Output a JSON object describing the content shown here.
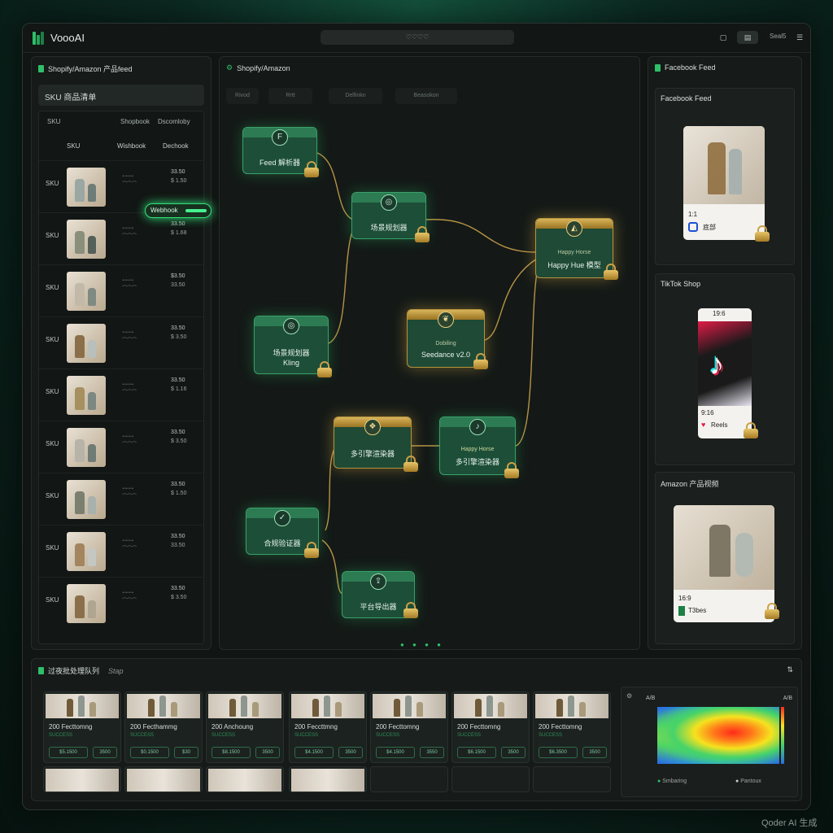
{
  "app": {
    "title": "VoooAI",
    "omnibox": "♡♡♡♡",
    "top_right_label": "Seal5",
    "watermark": "Qoder AI 生成"
  },
  "left_panel": {
    "title": "Shopify/Amazon 产品feed",
    "subbar": "SKU  商品清单",
    "header_top": {
      "c1": "SKU",
      "c2": "Shopbook",
      "c3": "Dscomloby"
    },
    "header": {
      "c1": "SKU",
      "c2": "Wishbook",
      "c3": "Dechook"
    },
    "rows": [
      {
        "sku": "SKU",
        "v1": "33.50",
        "v2": "$ 1.50"
      },
      {
        "sku": "SKU",
        "v1": "33.50",
        "v2": "$ 1.68"
      },
      {
        "sku": "SKU",
        "v1": "$3.50",
        "v2": "33.50"
      },
      {
        "sku": "SKU",
        "v1": "33.50",
        "v2": "$ 3.50"
      },
      {
        "sku": "SKU",
        "v1": "33.50",
        "v2": "$ 1.16"
      },
      {
        "sku": "SKU",
        "v1": "33.50",
        "v2": "$ 3.50"
      },
      {
        "sku": "SKU",
        "v1": "33.50",
        "v2": "$ 1.50"
      },
      {
        "sku": "SKU",
        "v1": "33.50",
        "v2": "33.50"
      },
      {
        "sku": "SKU",
        "v1": "33.50",
        "v2": "$ 3.50"
      }
    ],
    "webhook_label": "Webhook"
  },
  "canvas": {
    "title": "Shopify/Amazon",
    "tabs": [
      "Rivod",
      "Rrtt",
      "Delfinkn",
      "Beasokon"
    ],
    "nodes": {
      "feed_parser": "Feed 解析器",
      "scene_planner_1": "场景规划器",
      "happy_horse_top_a": "Happy Horse",
      "happy_horse_top_b": "Happy Hue 模型",
      "scene_planner_2_a": "场景规划器",
      "scene_planner_2_b": "Kling",
      "seedance_a": "Dobiling",
      "seedance_b": "Seedance v2.0",
      "renderer_1": "多引擎渲染器",
      "happy_horse_bottom_a": "Happy Horse",
      "happy_horse_bottom_b": "多引擎渲染器",
      "compliance": "合规验证器",
      "exporter": "平台导出器"
    }
  },
  "right_panel": {
    "title": "Facebook Feed",
    "facebook": {
      "title": "Facebook Feed",
      "ratio": "1:1",
      "tag": "底部"
    },
    "tiktok": {
      "title": "TikTok Shop",
      "top": "19:6",
      "ratio": "9:16",
      "tag": "Reels"
    },
    "amazon": {
      "title": "Amazon 产品视频",
      "ratio": "16:9",
      "tag": "T3bes"
    }
  },
  "bottom": {
    "title": "过夜批处理队列",
    "subtitle": "Stap",
    "queue": [
      {
        "title": "200 Fecttomng",
        "status": "SUCCESS",
        "p1": "$5.1500",
        "p2": "3500"
      },
      {
        "title": "200 Fecthammg",
        "status": "SUCCESS",
        "p1": "$0.1500",
        "p2": "$30"
      },
      {
        "title": "200 Anchoung",
        "status": "SUCCESS",
        "p1": "$8.1500",
        "p2": "3500"
      },
      {
        "title": "200 Feccttmng",
        "status": "SUCCESS",
        "p1": "$4.1500",
        "p2": "3500"
      },
      {
        "title": "200 Fecttomng",
        "status": "SUCCESS",
        "p1": "$4.1500",
        "p2": "3550"
      },
      {
        "title": "200 Fecttomng",
        "status": "SUCCESS",
        "p1": "$6.1500",
        "p2": "3500"
      },
      {
        "title": "200 Fecttomng",
        "status": "SUCCESS",
        "p1": "$6.3500",
        "p2": "3500"
      }
    ],
    "heatmap": {
      "label_left": "A/B",
      "label_right": "A/B",
      "legend_a": "Smbaring",
      "legend_b": "Pantoux"
    }
  },
  "colors": {
    "accent": "#2fbf6b",
    "gold": "#c9a14a",
    "bg": "#111513"
  }
}
